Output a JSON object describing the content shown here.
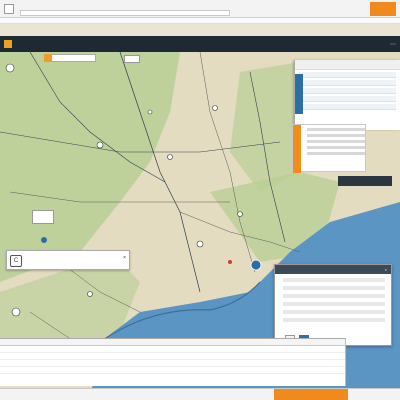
{
  "colors": {
    "accent": "#f08a1c",
    "navbar": "#1e2a33",
    "water": "#5b95c4",
    "land": "#e4dcc0",
    "green": "#b7cf94"
  },
  "browser": {
    "tabs": [
      "",
      "",
      "",
      "",
      ""
    ],
    "address": "",
    "links": [
      "",
      "",
      ""
    ]
  },
  "navbar": {
    "items": [
      "",
      "",
      "",
      "",
      "",
      "",
      "",
      ""
    ],
    "right_button": ""
  },
  "map": {
    "search_placeholder": "",
    "label_top": "",
    "marker_text": ""
  },
  "route_card": {
    "label": "",
    "icon_letter": "C",
    "close": "×"
  },
  "small_card": {
    "text": ""
  },
  "chip_right": {
    "text": ""
  },
  "dialog": {
    "title": "",
    "lines": [
      "",
      "",
      "",
      "",
      "",
      ""
    ],
    "buttons": [
      "",
      ""
    ],
    "close": "×"
  },
  "bottom_table": {
    "rows": [
      [
        "",
        "",
        "",
        ""
      ],
      [
        "",
        "",
        "",
        ""
      ],
      [
        "",
        "",
        "",
        ""
      ],
      [
        "",
        "",
        "",
        ""
      ],
      [
        "",
        "",
        "",
        ""
      ]
    ]
  },
  "statusbar": {
    "left": "",
    "mid": ""
  }
}
